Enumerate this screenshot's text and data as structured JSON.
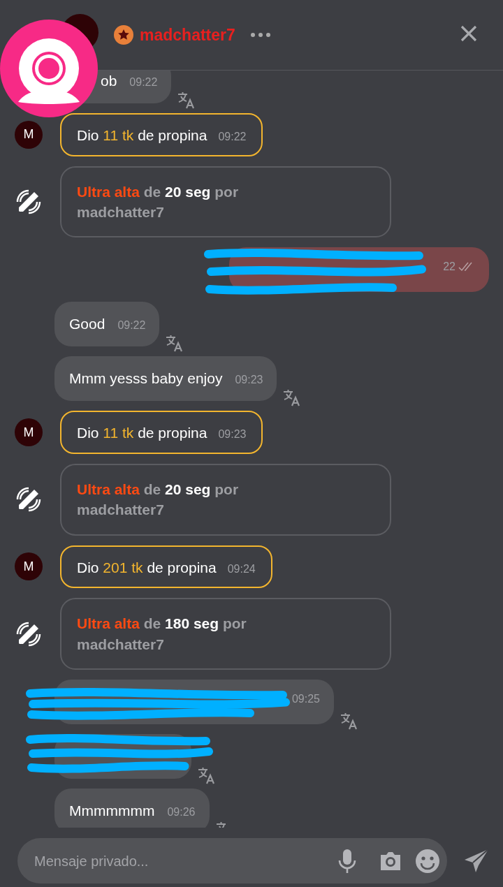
{
  "header": {
    "username": "madchatter7"
  },
  "messages": [
    {
      "kind": "text",
      "text": "ob",
      "time": "09:22",
      "redacted": false
    },
    {
      "kind": "tip",
      "avatar_letter": "M",
      "prefix": "Dio",
      "amount": "11 tk",
      "suffix": "de propina",
      "time": "09:22"
    },
    {
      "kind": "vibe",
      "level": "Ultra alta",
      "de": "de",
      "duration": "20 seg",
      "por": "por",
      "by": "madchatter7"
    },
    {
      "kind": "own",
      "time": "22",
      "redacted": true
    },
    {
      "kind": "text",
      "text": "Good",
      "time": "09:22",
      "redacted": false
    },
    {
      "kind": "text",
      "text": "Mmm yesss baby enjoy",
      "time": "09:23",
      "redacted": false
    },
    {
      "kind": "tip",
      "avatar_letter": "M",
      "prefix": "Dio",
      "amount": "11 tk",
      "suffix": "de propina",
      "time": "09:23"
    },
    {
      "kind": "vibe",
      "level": "Ultra alta",
      "de": "de",
      "duration": "20 seg",
      "por": "por",
      "by": "madchatter7"
    },
    {
      "kind": "tip",
      "avatar_letter": "M",
      "prefix": "Dio",
      "amount": "201 tk",
      "suffix": "de propina",
      "time": "09:24"
    },
    {
      "kind": "vibe",
      "level": "Ultra alta",
      "de": "de",
      "duration": "180 seg",
      "por": "por",
      "by": "madchatter7"
    },
    {
      "kind": "text",
      "time": "09:25",
      "redacted": true
    },
    {
      "kind": "text",
      "redacted": true
    },
    {
      "kind": "text",
      "text": "Mmmmmmm",
      "time": "09:26",
      "redacted": false
    }
  ],
  "composer": {
    "placeholder": "Mensaje privado..."
  }
}
